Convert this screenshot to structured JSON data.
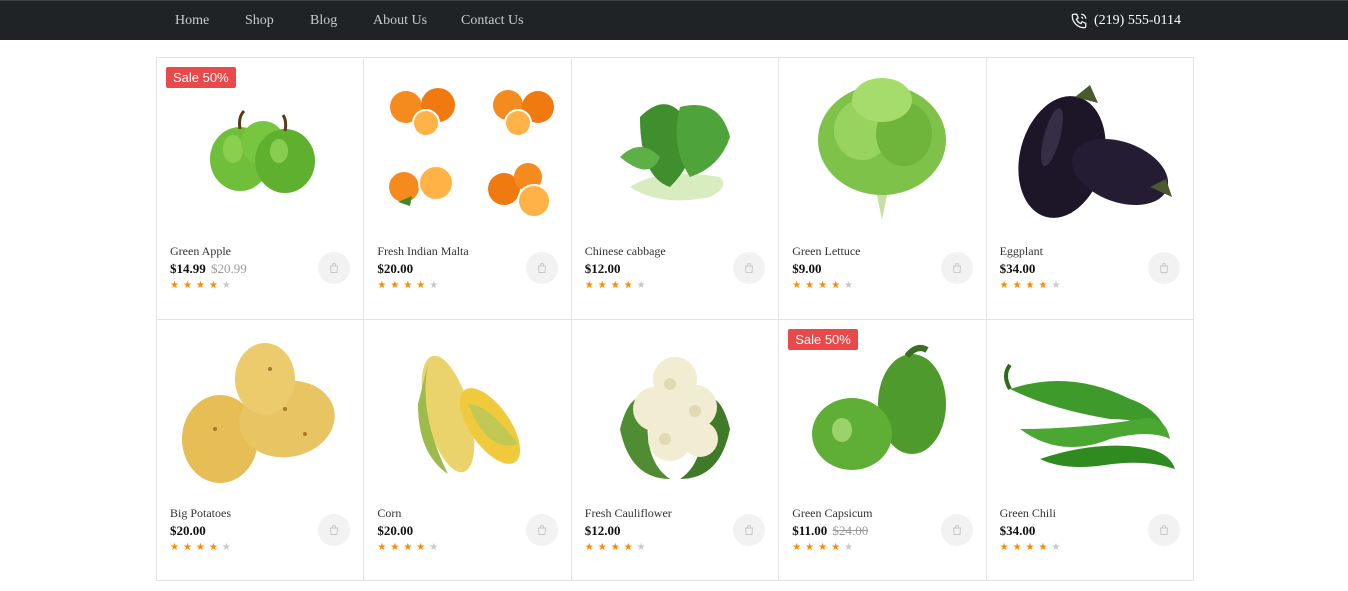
{
  "nav": {
    "items": [
      "Home",
      "Shop",
      "Blog",
      "About Us",
      "Contact Us"
    ],
    "phone": "(219) 555-0114",
    "phone_icon": "phone-icon"
  },
  "products": [
    {
      "name": "Green Apple",
      "price": "$14.99",
      "old_price": "$20.99",
      "old_strike": false,
      "badge": "Sale 50%",
      "rating": 4,
      "image": "apple"
    },
    {
      "name": "Fresh Indian Malta",
      "price": "$20.00",
      "old_price": "",
      "badge": "",
      "rating": 4,
      "image": "orange"
    },
    {
      "name": "Chinese cabbage",
      "price": "$12.00",
      "old_price": "",
      "badge": "",
      "rating": 4,
      "image": "cabbage"
    },
    {
      "name": "Green Lettuce",
      "price": "$9.00",
      "old_price": "",
      "badge": "",
      "rating": 4,
      "image": "lettuce"
    },
    {
      "name": "Eggplant",
      "price": "$34.00",
      "old_price": "",
      "badge": "",
      "rating": 4,
      "image": "eggplant"
    },
    {
      "name": "Big Potatoes",
      "price": "$20.00",
      "old_price": "",
      "badge": "",
      "rating": 4,
      "image": "potato"
    },
    {
      "name": "Corn",
      "price": "$20.00",
      "old_price": "",
      "badge": "",
      "rating": 4,
      "image": "corn"
    },
    {
      "name": "Fresh Cauliflower",
      "price": "$12.00",
      "old_price": "",
      "badge": "",
      "rating": 4,
      "image": "cauliflower"
    },
    {
      "name": "Green Capsicum",
      "price": "$11.00",
      "old_price": "$24.00",
      "old_strike": true,
      "badge": "Sale 50%",
      "rating": 4,
      "image": "capsicum"
    },
    {
      "name": "Green Chili",
      "price": "$34.00",
      "old_price": "",
      "badge": "",
      "rating": 4,
      "image": "chili"
    }
  ],
  "colors": {
    "accent": "#ff8a00",
    "sale": "#e84a4a",
    "topbar": "#1f2326"
  }
}
